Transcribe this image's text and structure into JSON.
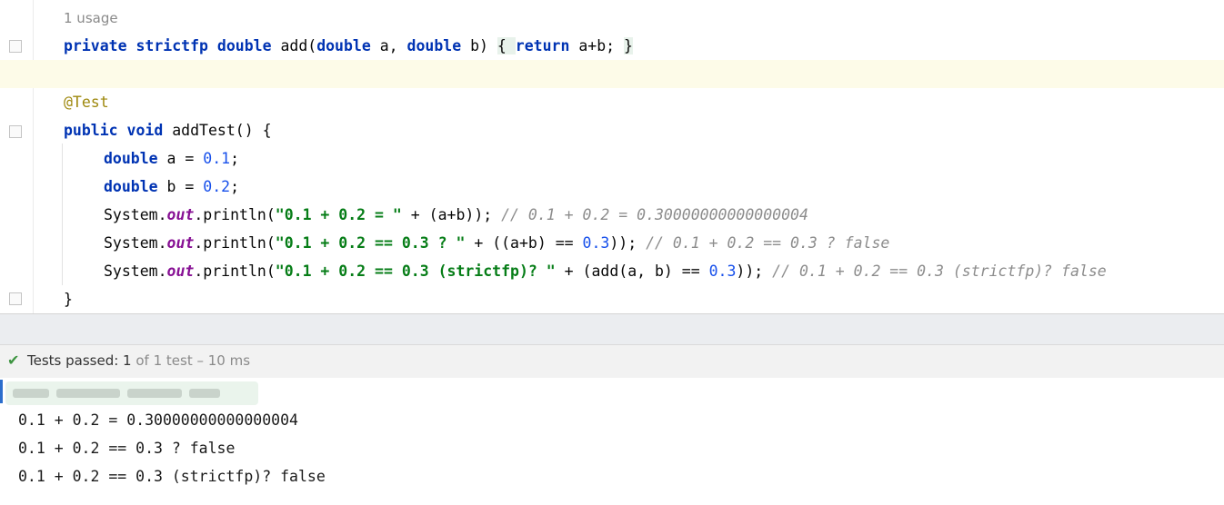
{
  "editor": {
    "usage_hint": "1 usage",
    "line1": {
      "k_private": "private",
      "k_strictfp": "strictfp",
      "k_double": "double",
      "sig_name": " add(",
      "p1_type": "double",
      "p1_name": " a, ",
      "p2_type": "double",
      "p2_name": " b) ",
      "body_open": "{ ",
      "k_return": "return",
      "body_expr": " a+b; ",
      "body_close": "}"
    },
    "annotation": "@Test",
    "line_method": {
      "k_public": "public",
      "k_void": "void",
      "name": " addTest() {"
    },
    "decl_a": {
      "type": "double",
      "name": " a = ",
      "value": "0.1",
      "end": ";"
    },
    "decl_b": {
      "type": "double",
      "name": " b = ",
      "value": "0.2",
      "end": ";"
    },
    "print1": {
      "sys": "System.",
      "out": "out",
      "call": ".println(",
      "str": "\"0.1 + 0.2 = \"",
      "rest": " + (a+b)); ",
      "comment": "// 0.1 + 0.2 = 0.30000000000000004"
    },
    "print2": {
      "sys": "System.",
      "out": "out",
      "call": ".println(",
      "str": "\"0.1 + 0.2 == 0.3 ? \"",
      "mid": " + ((a+b) == ",
      "num": "0.3",
      "end": ")); ",
      "comment": "// 0.1 + 0.2 == 0.3 ? false"
    },
    "print3": {
      "sys": "System.",
      "out": "out",
      "call": ".println(",
      "str": "\"0.1 + 0.2 == 0.3 (strictfp)? \"",
      "mid": " + (add(a, b) == ",
      "num": "0.3",
      "end": ")); ",
      "comment": "// 0.1 + 0.2 == 0.3 (strictfp)? false"
    },
    "close_brace": "}"
  },
  "test_status": {
    "icon": "checkmark-icon",
    "label": "Tests passed: ",
    "passed": "1",
    "of_text": " of 1 test – 10 ms",
    "status_color": "#3d9440"
  },
  "console": {
    "lines": [
      "0.1 + 0.2 = 0.30000000000000004",
      "0.1 + 0.2 == 0.3 ? false",
      "0.1 + 0.2 == 0.3 (strictfp)? false"
    ]
  }
}
